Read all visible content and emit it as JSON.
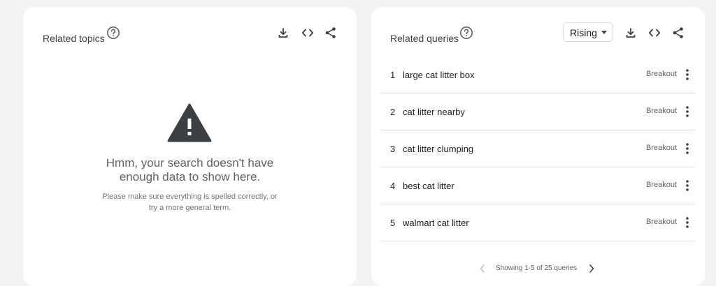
{
  "left_card": {
    "title": "Related topics",
    "empty_title_line1": "Hmm, your search doesn't have",
    "empty_title_line2": "enough data to show here.",
    "empty_sub_line1": "Please make sure everything is spelled correctly, or",
    "empty_sub_line2": "try a more general term."
  },
  "right_card": {
    "title": "Related queries",
    "dropdown_selected": "Rising",
    "rows": [
      {
        "rank": "1",
        "query": "large cat litter box",
        "value": "Breakout"
      },
      {
        "rank": "2",
        "query": "cat litter nearby",
        "value": "Breakout"
      },
      {
        "rank": "3",
        "query": "cat litter clumping",
        "value": "Breakout"
      },
      {
        "rank": "4",
        "query": "best cat litter",
        "value": "Breakout"
      },
      {
        "rank": "5",
        "query": "walmart cat litter",
        "value": "Breakout"
      }
    ],
    "pager_text": "Showing 1-5 of 25 queries"
  },
  "icons": {
    "help": "help-circle-icon",
    "download": "download-icon",
    "embed": "code-icon",
    "share": "share-icon",
    "warning": "warning-icon",
    "more": "more-vert-icon",
    "prev": "chevron-left-icon",
    "next": "chevron-right-icon"
  },
  "colors": {
    "background": "#f1f3f4",
    "card": "#ffffff",
    "icon": "#3c4043",
    "warning": "#3c4043",
    "muted": "#5f6368"
  }
}
